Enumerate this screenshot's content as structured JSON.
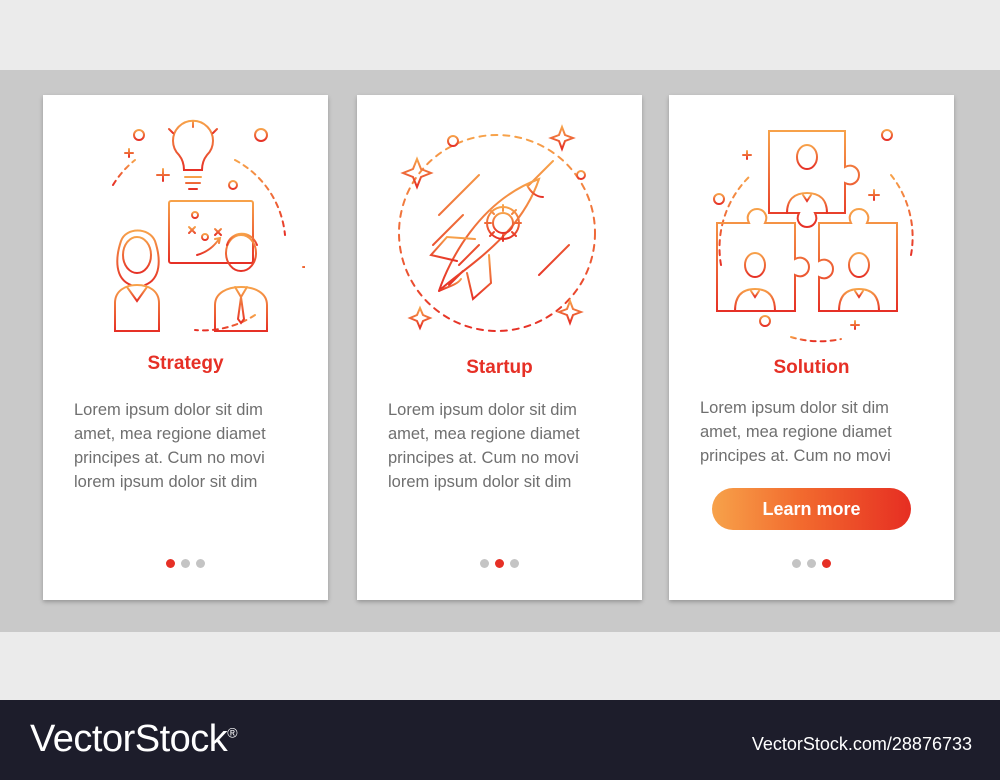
{
  "cards": [
    {
      "title": "Strategy",
      "body": [
        "Lorem ipsum dolor sit dim",
        "amet, mea regione diamet",
        "principes at. Cum no movi",
        "lorem ipsum dolor sit dim"
      ],
      "illustration_icon": "strategy-people-whiteboard-icon",
      "page_indicator_active": 1
    },
    {
      "title": "Startup",
      "body": [
        "Lorem ipsum dolor sit dim",
        "amet, mea regione diamet",
        "principes at. Cum no movi",
        "lorem ipsum dolor sit dim"
      ],
      "illustration_icon": "rocket-gear-icon",
      "page_indicator_active": 2
    },
    {
      "title": "Solution",
      "body": [
        "Lorem ipsum dolor sit dim",
        "amet, mea regione diamet",
        "principes at. Cum no movi"
      ],
      "illustration_icon": "puzzle-team-icon",
      "cta_label": "Learn more",
      "page_indicator_active": 3
    }
  ],
  "page_indicator_count": 3,
  "footer": {
    "logo": "VectorStock",
    "registered_mark": "®",
    "credit": "VectorStock.com/28876733"
  },
  "colors": {
    "accent_red": "#e63026",
    "accent_orange": "#f7a24a",
    "text_gray": "#6f6f6f",
    "footer_bg": "#1d1d2b"
  }
}
